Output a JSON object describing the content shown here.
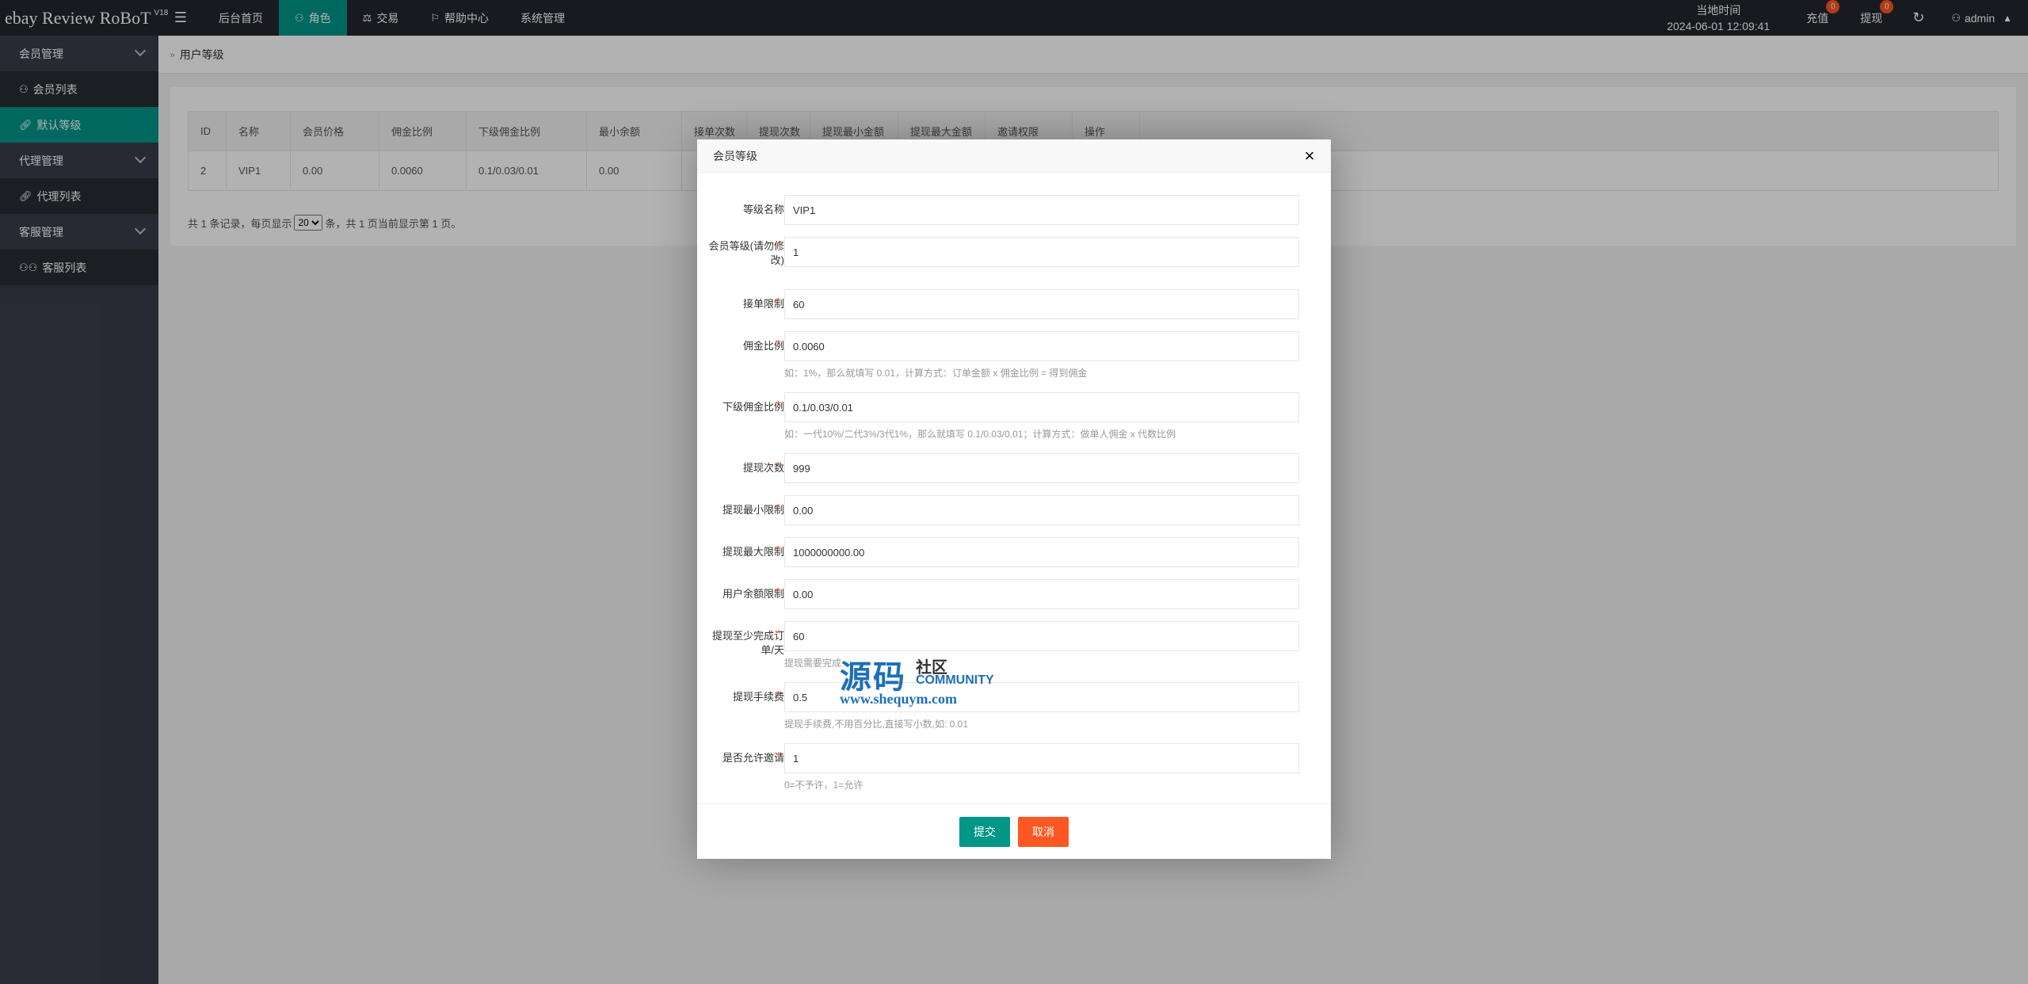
{
  "app": {
    "brand": "ebay Review RoBoT",
    "version": "V18"
  },
  "nav": {
    "toggle": "☰",
    "items": [
      {
        "label": "后台首页",
        "icon": ""
      },
      {
        "label": "角色",
        "icon": "user-icon"
      },
      {
        "label": "交易",
        "icon": "scale-icon"
      },
      {
        "label": "帮助中心",
        "icon": "flag-icon"
      },
      {
        "label": "系统管理",
        "icon": ""
      }
    ]
  },
  "header": {
    "clock_label": "当地时间",
    "clock_value": "2024-06-01 12:09:41",
    "recharge_label": "充值",
    "recharge_badge": "0",
    "withdraw_label": "提现",
    "withdraw_badge": "0",
    "user": "admin"
  },
  "sidebar": {
    "groups": [
      {
        "label": "会员管理",
        "children": [
          {
            "label": "会员列表",
            "icon": "user-icon"
          },
          {
            "label": "默认等级",
            "icon": "link-icon"
          }
        ]
      },
      {
        "label": "代理管理",
        "children": [
          {
            "label": "代理列表",
            "icon": "link-icon"
          }
        ]
      },
      {
        "label": "客服管理",
        "children": [
          {
            "label": "客服列表",
            "icon": "users-icon"
          }
        ]
      }
    ]
  },
  "breadcrumb": {
    "sep": "»",
    "current": "用户等级"
  },
  "table": {
    "headers": [
      "ID",
      "名称",
      "会员价格",
      "佣金比例",
      "下级佣金比例",
      "最小余额",
      "接单次数",
      "提现次数",
      "提现最小金额",
      "提现最大金额",
      "邀请权限",
      "操作"
    ],
    "rows": [
      [
        "2",
        "VIP1",
        "0.00",
        "0.0060",
        "0.1/0.03/0.01",
        "0.00",
        "",
        "",
        "",
        "",
        "",
        ""
      ]
    ]
  },
  "pager": {
    "prefix": "共 1 条记录，每页显示",
    "page_size": "20",
    "suffix": "条，共 1 页当前显示第 1 页。"
  },
  "modal": {
    "title": "会员等级",
    "close": "×",
    "fields": [
      {
        "label": "等级名称",
        "required": false,
        "value": "VIP1",
        "tip": ""
      },
      {
        "label": "会员等级(请勿修改)",
        "required": true,
        "value": "1",
        "tip": ""
      },
      {
        "label": "接单限制",
        "required": true,
        "value": "60",
        "tip": ""
      },
      {
        "label": "佣金比例",
        "required": true,
        "value": "0.0060",
        "tip": "如：1%，那么就填写 0.01，计算方式：订单金额 x 佣金比例 = 得到佣金"
      },
      {
        "label": "下级佣金比例",
        "required": true,
        "value": "0.1/0.03/0.01",
        "tip": "如：一代10%/二代3%/3代1%，那么就填写 0.1/0.03/0.01；计算方式：做单人佣金 x 代数比例"
      },
      {
        "label": "提现次数",
        "required": true,
        "value": "999",
        "tip": ""
      },
      {
        "label": "提现最小限制",
        "required": true,
        "value": "0.00",
        "tip": ""
      },
      {
        "label": "提现最大限制",
        "required": true,
        "value": "1000000000.00",
        "tip": ""
      },
      {
        "label": "用户余额限制",
        "required": true,
        "value": "0.00",
        "tip": ""
      },
      {
        "label": "提现至少完成订单/天",
        "required": true,
        "value": "60",
        "tip": "提现需要完成"
      },
      {
        "label": "提现手续费",
        "required": true,
        "value": "0.5",
        "tip": "提现手续费,不用百分比,直接写小数,如: 0.01"
      },
      {
        "label": "是否允许邀请",
        "required": true,
        "value": "1",
        "tip": "0=不予许，1=允许"
      }
    ],
    "submit": "提交",
    "cancel": "取消"
  },
  "watermark": {
    "big": "源码",
    "small": "社区",
    "comm": "COMMUNITY",
    "url": "www.shequym.com"
  },
  "colors": {
    "header_bg": "#23262e",
    "sidebar_bg": "#393d49",
    "accent": "#009688",
    "danger": "#ff5722"
  }
}
